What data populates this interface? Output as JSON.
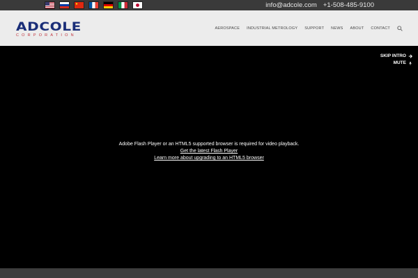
{
  "topbar": {
    "flags": [
      {
        "name": "flag-us-icon"
      },
      {
        "name": "flag-ru-icon"
      },
      {
        "name": "flag-cn-icon"
      },
      {
        "name": "flag-fr-icon"
      },
      {
        "name": "flag-de-icon"
      },
      {
        "name": "flag-it-icon"
      },
      {
        "name": "flag-jp-icon"
      }
    ],
    "email": "info@adcole.com",
    "phone": "+1-508-485-9100"
  },
  "header": {
    "logo_main": "ADCOLE",
    "logo_sub": "CORPORATION",
    "nav": [
      "AEROSPACE",
      "INDUSTRIAL METROLOGY",
      "SUPPORT",
      "NEWS",
      "ABOUT",
      "CONTACT"
    ]
  },
  "video": {
    "skip_intro": "SKIP INTRO",
    "mute": "MUTE",
    "flash_required": "Adobe Flash Player or an HTML5 supported browser is required for video playback.",
    "get_flash": "Get the latest Flash Player",
    "learn_html5": "Learn more about upgrading to an HTML5 browser"
  },
  "colors": {
    "topbar": "#3a3a3a",
    "header": "#ececec",
    "logo_blue": "#1a2e78",
    "logo_red": "#c0303a"
  }
}
